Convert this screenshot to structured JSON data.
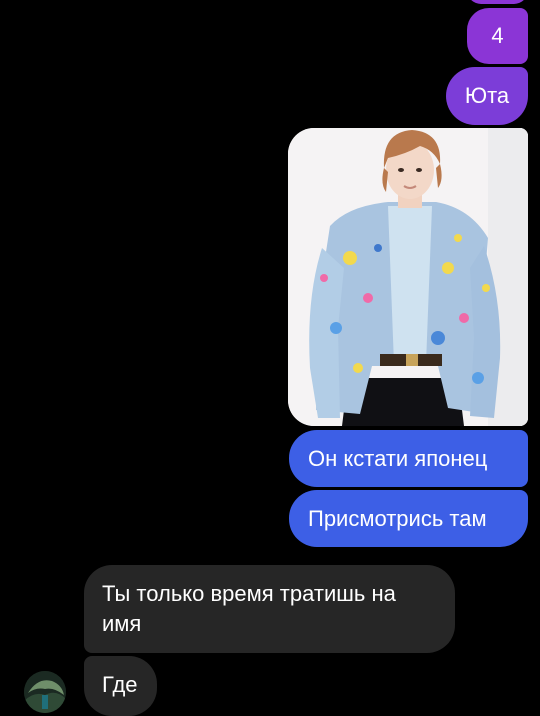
{
  "conversation": {
    "messages": [
      {
        "id": "m0",
        "from": "me",
        "text": ""
      },
      {
        "id": "m1",
        "from": "me",
        "text": "4"
      },
      {
        "id": "m2",
        "from": "me",
        "text": "Юта"
      },
      {
        "id": "m3",
        "from": "me",
        "type": "photo",
        "icon": "photo-of-person-in-paint-splatter-denim-jacket"
      },
      {
        "id": "m4",
        "from": "me",
        "text": "Он кстати японец"
      },
      {
        "id": "m5",
        "from": "me",
        "text": "Присмотрись там"
      },
      {
        "id": "m6",
        "from": "them",
        "text": "Ты только время тратишь на имя"
      },
      {
        "id": "m7",
        "from": "them",
        "text": "Где"
      }
    ]
  },
  "colors": {
    "background": "#000000",
    "outgoing_purple": "#8b35d6",
    "outgoing_violet": "#7c3dd8",
    "outgoing_blue": "#3d5fe6",
    "incoming_gray": "#262626",
    "text": "#ffffff"
  }
}
